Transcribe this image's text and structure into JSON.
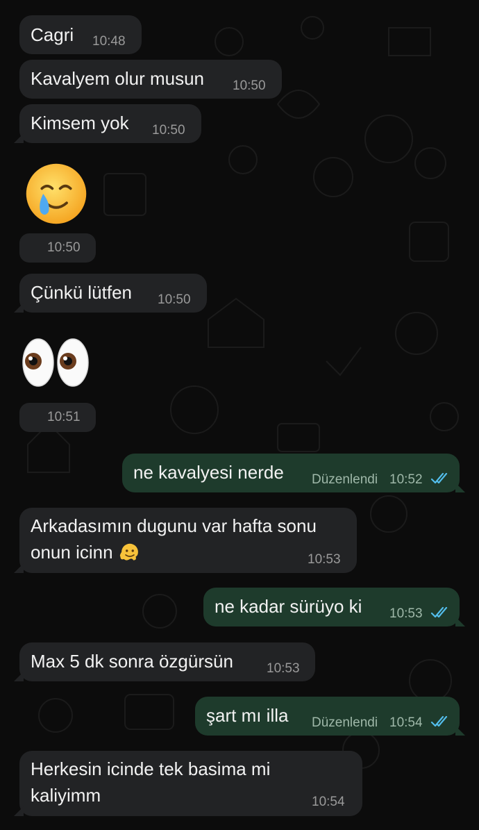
{
  "messages": [
    {
      "id": "m1",
      "direction": "incoming",
      "text": "Cagri",
      "time": "10:48"
    },
    {
      "id": "m2",
      "direction": "incoming",
      "text": "Kavalyem olur musun",
      "time": "10:50"
    },
    {
      "id": "m3",
      "direction": "incoming",
      "text": "Kimsem yok",
      "time": "10:50"
    },
    {
      "id": "m4",
      "direction": "incoming",
      "emoji": "smiling-face-with-tear-icon",
      "time": "10:50"
    },
    {
      "id": "m5",
      "direction": "incoming",
      "text": "Çünkü lütfen",
      "time": "10:50"
    },
    {
      "id": "m6",
      "direction": "incoming",
      "emoji": "eyes-icon",
      "time": "10:51"
    },
    {
      "id": "m7",
      "direction": "outgoing",
      "text": "ne kavalyesi nerde",
      "edited_label": "Düzenlendi",
      "time": "10:52",
      "status": "read"
    },
    {
      "id": "m8",
      "direction": "incoming",
      "text_line1": "Arkadasımın dugunu var hafta sonu",
      "text_line2": "onun icinn",
      "emoji": "melting-face-icon",
      "time": "10:53"
    },
    {
      "id": "m9",
      "direction": "outgoing",
      "text": "ne kadar sürüyo ki",
      "time": "10:53",
      "status": "read"
    },
    {
      "id": "m10",
      "direction": "incoming",
      "text": "Max 5 dk sonra özgürsün",
      "time": "10:53"
    },
    {
      "id": "m11",
      "direction": "outgoing",
      "text": "şart mı illa",
      "edited_label": "Düzenlendi",
      "time": "10:54",
      "status": "read"
    },
    {
      "id": "m12",
      "direction": "incoming",
      "text_line1": "Herkesin icinde tek basima mi",
      "text_line2": "kaliyimm",
      "time": "10:54"
    }
  ],
  "colors": {
    "background": "#0c0c0c",
    "incoming_bubble": "#222325",
    "outgoing_bubble": "#1e3b2c",
    "read_ticks": "#53bdeb",
    "timestamp": "#9a9a9a"
  }
}
